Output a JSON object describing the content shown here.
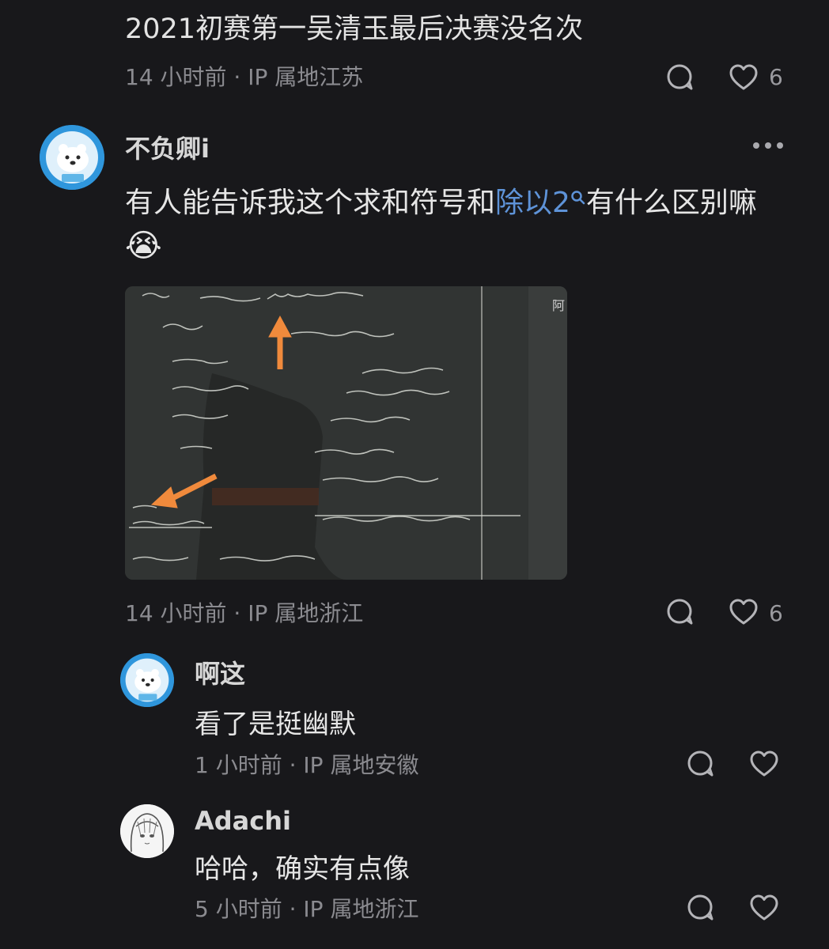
{
  "top_comment": {
    "text": "2021初赛第一吴清玉最后决赛没名次",
    "meta": "14 小时前 · IP 属地江苏",
    "likes": "6"
  },
  "main_comment": {
    "username": "不负卿i",
    "text_prefix": "有人能告诉我这个求和符号和",
    "link_text": "除以2",
    "text_suffix": "有什么区别嘛",
    "emoji": "😭",
    "meta": "14 小时前 · IP 属地浙江",
    "likes": "6"
  },
  "replies": [
    {
      "username": "啊这",
      "text": "看了是挺幽默",
      "meta": "1 小时前 · IP 属地安徽"
    },
    {
      "username": "Adachi",
      "text": "哈哈，确实有点像",
      "meta": "5 小时前 · IP 属地浙江"
    }
  ],
  "photo": {
    "corner_label": "阿"
  },
  "colors": {
    "background": "#18181b",
    "link": "#5e93d8",
    "meta": "#8b8b90",
    "arrow": "#f08a3c"
  },
  "icons": {
    "reply": "comment-bubble-icon",
    "like": "heart-icon",
    "more": "more-dots-icon",
    "search": "search-magnifier-icon"
  }
}
